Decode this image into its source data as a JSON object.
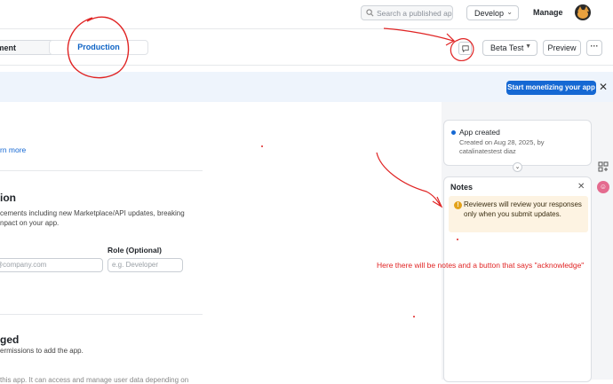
{
  "topbar": {
    "search_placeholder": "Search a published app",
    "develop_label": "Develop",
    "manage_label": "Manage",
    "avatar_name": "cat-avatar"
  },
  "subbar": {
    "tabs": [
      {
        "label": "Development",
        "visible_text": "oment"
      },
      {
        "label": "Production",
        "active": true
      }
    ],
    "beta_label": "Beta Test",
    "preview_label": "Preview",
    "more_label": "···"
  },
  "banner": {
    "button_label": "Start monetizing your app",
    "close_label": "✕"
  },
  "main": {
    "learn_more": "rn more",
    "notification": {
      "title": "ion",
      "desc_line1": "cements including new Marketplace/API updates, breaking",
      "desc_line2": "npact on your app."
    },
    "role_label": "Role (Optional)",
    "email_placeholder": "@company.com",
    "role_placeholder": "e.g. Developer",
    "managed": {
      "title": "ged",
      "desc": "ermissions to add the app."
    },
    "cut_text": "this app. It can access and manage user data depending on"
  },
  "panel": {
    "activity": {
      "title": "App created",
      "meta": "Created on Aug 28, 2025, by catalinatestest diaz"
    },
    "notes": {
      "title": "Notes",
      "close_label": "✕",
      "warning_text": "Reviewers will review your responses only when you submit updates."
    }
  },
  "annotation": {
    "text": "Here there will be notes and a button that says \"acknowledge\""
  },
  "colors": {
    "accent": "#1568d3",
    "annotation_red": "#e02424",
    "banner_bg": "#eef4fc",
    "warning_bg": "#fdf3e2"
  }
}
